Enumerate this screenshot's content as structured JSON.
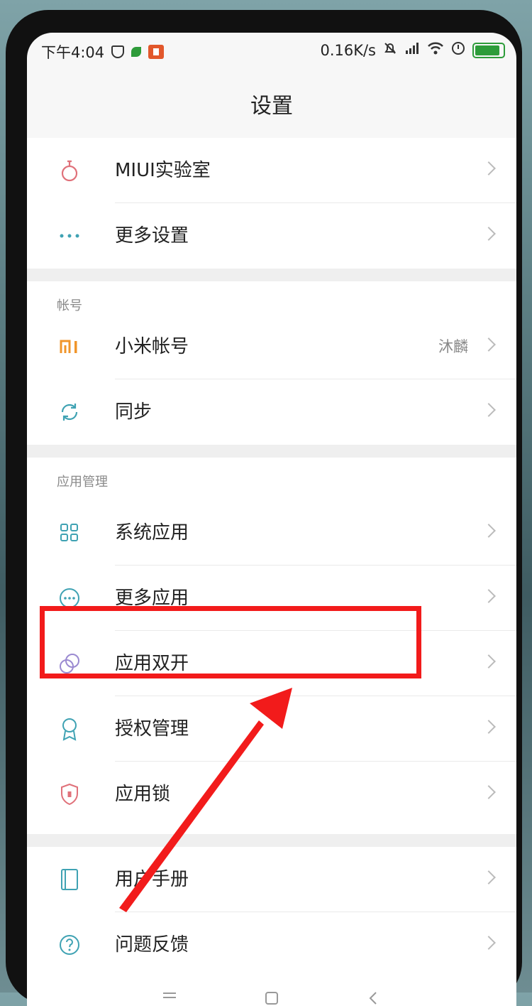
{
  "status": {
    "time": "下午4:04",
    "speed": "0.16K/s",
    "battery": "100"
  },
  "header": {
    "title": "设置"
  },
  "groups": [
    {
      "items": [
        {
          "label": "MIUI实验室",
          "icon": "flask-icon",
          "value": ""
        },
        {
          "label": "更多设置",
          "icon": "more-dots-icon",
          "value": ""
        }
      ]
    },
    {
      "title": "帐号",
      "items": [
        {
          "label": "小米帐号",
          "icon": "mi-logo-icon",
          "value": "沐麟"
        },
        {
          "label": "同步",
          "icon": "sync-icon",
          "value": ""
        }
      ]
    },
    {
      "title": "应用管理",
      "items": [
        {
          "label": "系统应用",
          "icon": "grid-apps-icon",
          "value": ""
        },
        {
          "label": "更多应用",
          "icon": "more-apps-icon",
          "value": ""
        },
        {
          "label": "应用双开",
          "icon": "dual-app-icon",
          "value": ""
        },
        {
          "label": "授权管理",
          "icon": "permission-icon",
          "value": ""
        },
        {
          "label": "应用锁",
          "icon": "app-lock-icon",
          "value": ""
        }
      ]
    },
    {
      "items": [
        {
          "label": "用户手册",
          "icon": "manual-icon",
          "value": ""
        },
        {
          "label": "问题反馈",
          "icon": "feedback-icon",
          "value": ""
        }
      ]
    }
  ],
  "annotation": {
    "color": "#f21b1b"
  },
  "colors": {
    "accent_teal": "#3fa2b3",
    "mi_orange": "#f0952a",
    "lab_red": "#e0717a"
  }
}
